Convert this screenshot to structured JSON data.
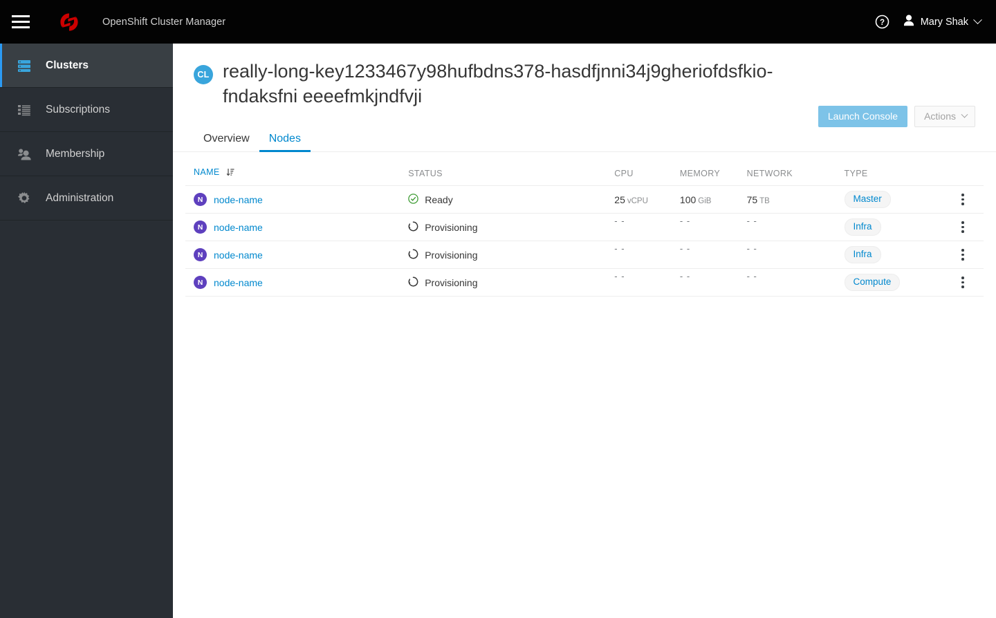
{
  "masthead": {
    "menu_toggle": "hamburger-menu",
    "brand": "Red Hat OpenShift logo",
    "title": "OpenShift Cluster Manager",
    "help_icon": "help-icon",
    "user_name": "Mary Shak"
  },
  "sidebar": {
    "items": [
      {
        "label": "Clusters",
        "icon": "server-icon",
        "active": true
      },
      {
        "label": "Subscriptions",
        "icon": "list-icon",
        "active": false
      },
      {
        "label": "Membership",
        "icon": "users-icon",
        "active": false
      },
      {
        "label": "Administration",
        "icon": "gear-icon",
        "active": false
      }
    ]
  },
  "page": {
    "badge": "CL",
    "cluster_name": "really-long-key1233467y98hufbdns378-hasdfjnni34j9gheriofdsfkio-fndaksfni eeeefmkjndfvji",
    "launch_console_label": "Launch Console",
    "actions_label": "Actions"
  },
  "tabs": [
    {
      "label": "Overview",
      "active": false
    },
    {
      "label": "Nodes",
      "active": true
    }
  ],
  "table": {
    "columns": [
      "NAME",
      "STATUS",
      "CPU",
      "MEMORY",
      "NETWORK",
      "TYPE"
    ],
    "sorted_column": "NAME",
    "sort_icon": "sort-amount-down-icon",
    "empty_value": "- -",
    "rows": [
      {
        "avatar": "N",
        "name": "node-name",
        "status": "Ready",
        "status_icon": "check-circle-icon",
        "cpu_value": "25",
        "cpu_unit": "vCPU",
        "memory_value": "100",
        "memory_unit": "GiB",
        "network_value": "75",
        "network_unit": "TB",
        "type": "Master"
      },
      {
        "avatar": "N",
        "name": "node-name",
        "status": "Provisioning",
        "status_icon": "spinner-icon",
        "cpu_value": "- -",
        "cpu_unit": "",
        "memory_value": "- -",
        "memory_unit": "",
        "network_value": "- -",
        "network_unit": "",
        "type": "Infra"
      },
      {
        "avatar": "N",
        "name": "node-name",
        "status": "Provisioning",
        "status_icon": "spinner-icon",
        "cpu_value": "- -",
        "cpu_unit": "",
        "memory_value": "- -",
        "memory_unit": "",
        "network_value": "- -",
        "network_unit": "",
        "type": "Infra"
      },
      {
        "avatar": "N",
        "name": "node-name",
        "status": "Provisioning",
        "status_icon": "spinner-icon",
        "cpu_value": "- -",
        "cpu_unit": "",
        "memory_value": "- -",
        "memory_unit": "",
        "network_value": "- -",
        "network_unit": "",
        "type": "Compute"
      }
    ]
  },
  "colors": {
    "masthead_bg": "#030303",
    "sidebar_bg": "#292e34",
    "sidebar_active_bg": "#393f44",
    "accent_blue": "#0088ce",
    "active_marker": "#2b9af3",
    "primary_button": "#7dc3e8",
    "cluster_badge": "#39a5dc",
    "node_badge": "#5e40be",
    "ready_green": "#3f9c35",
    "brand_red": "#cc0000",
    "muted_text": "#8b8d8f"
  }
}
